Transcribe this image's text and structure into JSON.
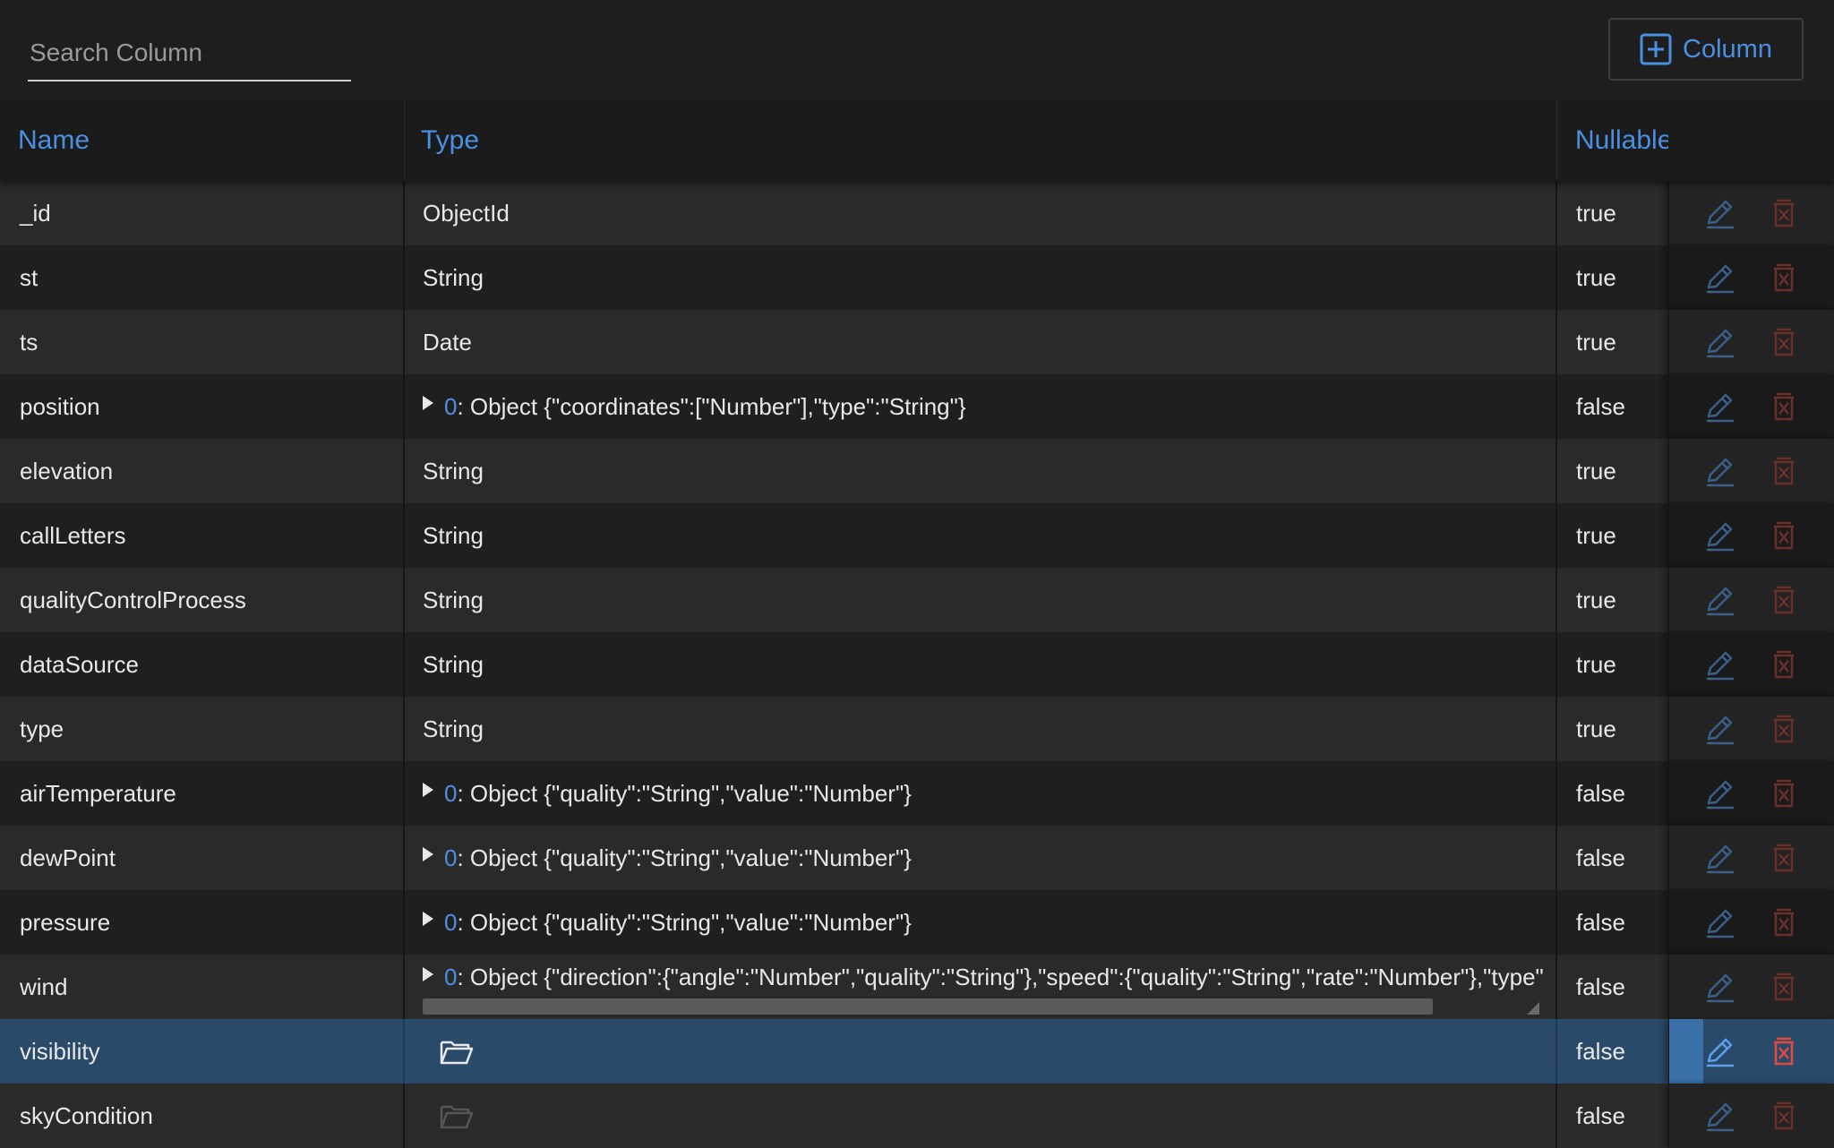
{
  "search": {
    "placeholder": "Search Column",
    "value": ""
  },
  "toolbar": {
    "add_column_label": "Column"
  },
  "columns": {
    "name": "Name",
    "type": "Type",
    "nullable": "Nullable"
  },
  "colors": {
    "accent": "#4a90e2",
    "edit": "#4a90e2",
    "delete": "#d9453a",
    "selected_row": "#2a4a6a"
  },
  "icons": {
    "add": "plus-square-icon",
    "edit": "pencil-icon",
    "delete": "delete-x-icon",
    "expand": "triangle-right-icon",
    "folder": "folder-open-icon"
  },
  "rows": [
    {
      "name": "_id",
      "type": "ObjectId",
      "nullable": "true"
    },
    {
      "name": "st",
      "type": "String",
      "nullable": "true"
    },
    {
      "name": "ts",
      "type": "Date",
      "nullable": "true"
    },
    {
      "name": "position",
      "idx": "0",
      "type": ": Object {\"coordinates\":[\"Number\"],\"type\":\"String\"}",
      "nullable": "false"
    },
    {
      "name": "elevation",
      "type": "String",
      "nullable": "true"
    },
    {
      "name": "callLetters",
      "type": "String",
      "nullable": "true"
    },
    {
      "name": "qualityControlProcess",
      "type": "String",
      "nullable": "true"
    },
    {
      "name": "dataSource",
      "type": "String",
      "nullable": "true"
    },
    {
      "name": "type",
      "type": "String",
      "nullable": "true"
    },
    {
      "name": "airTemperature",
      "idx": "0",
      "type": ": Object {\"quality\":\"String\",\"value\":\"Number\"}",
      "nullable": "false"
    },
    {
      "name": "dewPoint",
      "idx": "0",
      "type": ": Object {\"quality\":\"String\",\"value\":\"Number\"}",
      "nullable": "false"
    },
    {
      "name": "pressure",
      "idx": "0",
      "type": ": Object {\"quality\":\"String\",\"value\":\"Number\"}",
      "nullable": "false"
    },
    {
      "name": "wind",
      "idx": "0",
      "type": ": Object {\"direction\":{\"angle\":\"Number\",\"quality\":\"String\"},\"speed\":{\"quality\":\"String\",\"rate\":\"Number\"},\"type\"",
      "nullable": "false"
    },
    {
      "name": "visibility",
      "type": "",
      "nullable": "false"
    },
    {
      "name": "skyCondition",
      "type": "",
      "nullable": "false"
    }
  ]
}
